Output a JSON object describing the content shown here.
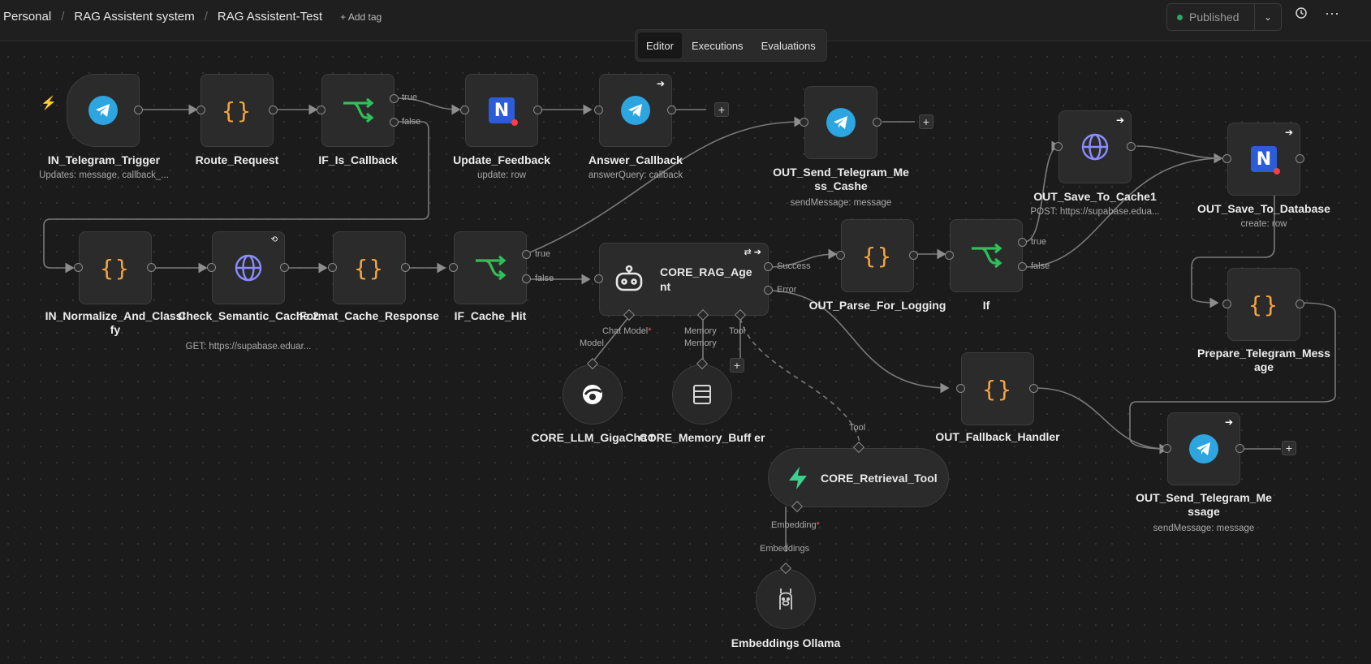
{
  "breadcrumb": {
    "items": [
      "Personal",
      "RAG Assistent system",
      "RAG Assistent-Test"
    ],
    "add_tag": "+ Add tag"
  },
  "header": {
    "status": "Published",
    "caret": "⌄",
    "history_icon": "history-icon",
    "more_icon": "ellipsis-icon"
  },
  "tabs": [
    "Editor",
    "Executions",
    "Evaluations"
  ],
  "nodes": {
    "in_trigger": {
      "label": "IN_Telegram_Trigger",
      "sub": "Updates: message, callback_..."
    },
    "route": {
      "label": "Route_Request"
    },
    "if_callback": {
      "label": "IF_Is_Callback",
      "true": "true",
      "false": "false"
    },
    "update_feedback": {
      "label": "Update_Feedback",
      "sub": "update: row"
    },
    "answer_callback": {
      "label": "Answer_Callback",
      "sub": "answerQuery: callback"
    },
    "out_send_cashe": {
      "label": "OUT_Send_Telegram_Me ss_Cashe",
      "sub": "sendMessage: message"
    },
    "save_cache": {
      "label": "OUT_Save_To_Cache1",
      "sub": "POST: https://supabase.edua..."
    },
    "save_db": {
      "label": "OUT_Save_To_Database",
      "sub": "create: row"
    },
    "normalize": {
      "label": "IN_Normalize_And_Classi fy"
    },
    "semantic": {
      "label": "Check_Semantic_Cache 2",
      "sub": "GET: https://supabase.eduar..."
    },
    "format_cache": {
      "label": "Format_Cache_Response"
    },
    "if_cache": {
      "label": "IF_Cache_Hit",
      "true": "true",
      "false": "false"
    },
    "agent": {
      "label": "CORE_RAG_Age nt",
      "success": "Success",
      "error": "Error",
      "chat_model": "Chat Model",
      "req": "*",
      "memory": "Memory",
      "tool": "Tool"
    },
    "parse_log": {
      "label": "OUT_Parse_For_Logging"
    },
    "if_node": {
      "label": "If",
      "true": "true",
      "false": "false"
    },
    "prepare": {
      "label": "Prepare_Telegram_Mess age"
    },
    "llm": {
      "label": "CORE_LLM_GigaCha t",
      "port": "Model"
    },
    "memory_buffer": {
      "label": "CORE_Memory_Buff er",
      "port": "Memory"
    },
    "fallback": {
      "label": "OUT_Fallback_Handler"
    },
    "send_message": {
      "label": "OUT_Send_Telegram_Me ssage",
      "sub": "sendMessage: message"
    },
    "retrieval": {
      "label": "CORE_Retrieval_Tool",
      "port": "Tool",
      "embedding": "Embedding",
      "req": "*"
    },
    "embeddings": {
      "label": "Embeddings Ollama",
      "port": "Embeddings"
    }
  }
}
